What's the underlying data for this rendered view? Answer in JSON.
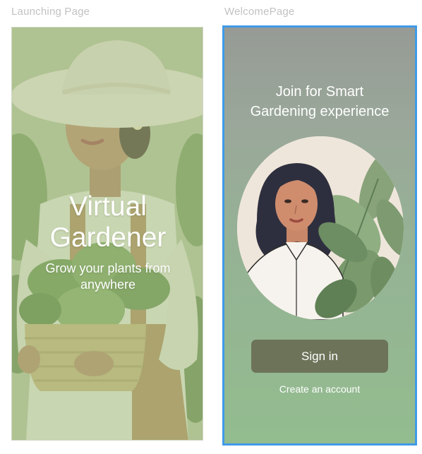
{
  "frames": {
    "launch": {
      "label": "Launching Page",
      "title_line1": "Virtual",
      "title_line2": "Gardener",
      "subtitle": "Grow your plants from anywhere"
    },
    "welcome": {
      "label": "WelcomePage",
      "heading_line1": "Join for Smart",
      "heading_line2": "Gardening experience",
      "signin_label": "Sign in",
      "create_account_label": "Create an account"
    }
  },
  "colors": {
    "selection_border": "#3f9be8",
    "signin_button_bg": "#6d7359",
    "launch_tint": "#a9bd89",
    "welcome_gradient_top": "#969b95",
    "welcome_gradient_bottom": "#93bc8f"
  },
  "images": {
    "launch_illustration": "woman-in-sun-hat-holding-basket-of-plants",
    "welcome_illustration": "woman-portrait-with-leaves"
  }
}
